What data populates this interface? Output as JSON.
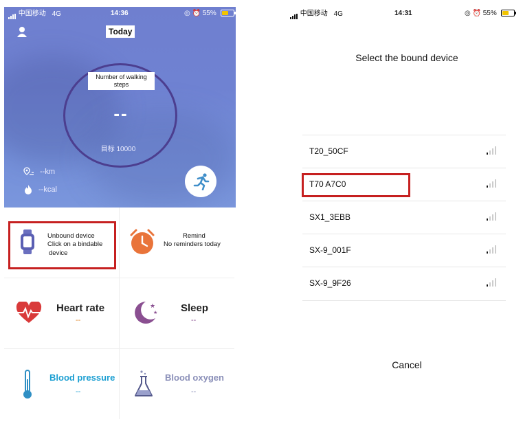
{
  "left": {
    "status": {
      "carrier": "中国移动",
      "network": "4G",
      "time": "14:36",
      "battery": "55%"
    },
    "header": {
      "title": "Today"
    },
    "steps": {
      "label": "Number of walking steps",
      "value": "--",
      "goal": "目标 10000"
    },
    "stats": {
      "distance": "--km",
      "calories": "--kcal"
    },
    "tiles": {
      "device": {
        "line1": "Unbound device",
        "line2": "Click on a bindable",
        "line3": "device"
      },
      "remind": {
        "title": "Remind",
        "subtitle": "No reminders today"
      },
      "heart": {
        "title": "Heart rate",
        "value": "--",
        "color": "#e0862a"
      },
      "sleep": {
        "title": "Sleep",
        "value": "--",
        "color": "#8a4f91"
      },
      "bp": {
        "title": "Blood pressure",
        "value": "--",
        "color": "#1c9fd2"
      },
      "oxygen": {
        "title": "Blood oxygen",
        "value": "--",
        "color": "#8a8fb8"
      }
    }
  },
  "right": {
    "status": {
      "carrier": "中国移动",
      "network": "4G",
      "time": "14:31",
      "battery": "55%"
    },
    "title": "Select the bound device",
    "devices": [
      {
        "name": "T20_50CF"
      },
      {
        "name": "T70 A7C0"
      },
      {
        "name": "SX1_3EBB"
      },
      {
        "name": "SX-9_001F"
      },
      {
        "name": "SX-9_9F26"
      }
    ],
    "cancel": "Cancel"
  },
  "colors": {
    "highlight": "#c62020",
    "hero_blue": "#7183d2",
    "ring": "#4c3e8f"
  },
  "icons": [
    "user-icon",
    "alarm-icon",
    "location-icon",
    "flame-icon",
    "running-icon",
    "watch-icon",
    "clock-icon",
    "heart-icon",
    "moon-icon",
    "thermometer-icon",
    "flask-icon",
    "signal-icon"
  ]
}
